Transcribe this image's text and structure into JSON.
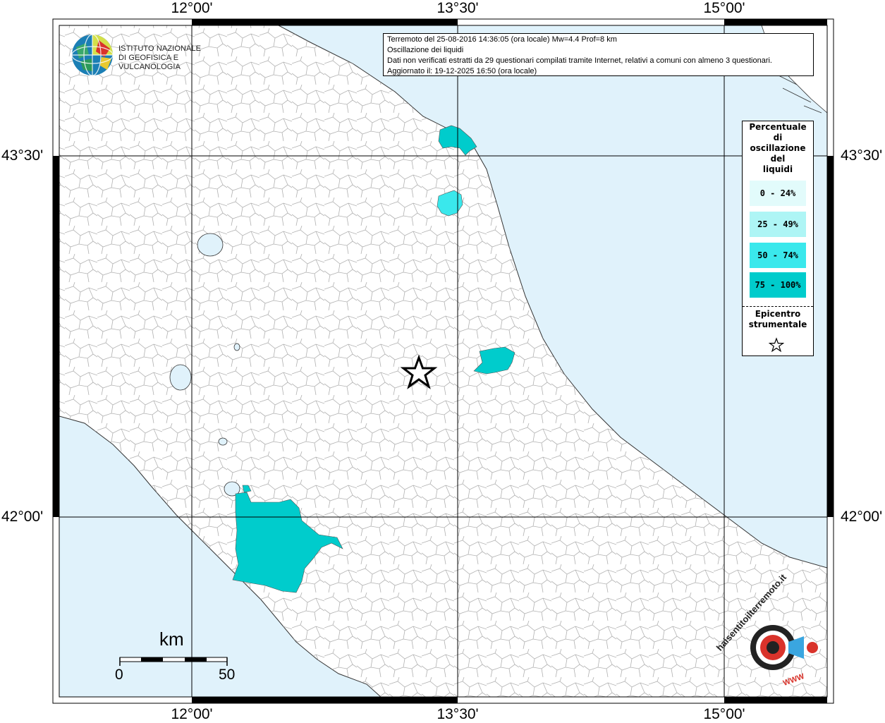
{
  "coordinates": {
    "top": [
      "12°00'",
      "13°30'",
      "15°00'"
    ],
    "bottom": [
      "12°00'",
      "13°30'",
      "15°00'"
    ],
    "left": [
      "43°30'",
      "42°00'"
    ],
    "right": [
      "43°30'",
      "42°00'"
    ]
  },
  "logo": {
    "line1": "ISTITUTO NAZIONALE",
    "line2": "DI GEOFISICA E VULCANOLOGIA"
  },
  "info": {
    "line1": "Terremoto del 25-08-2016 14:36:05 (ora locale) Mw=4.4 Prof=8 km",
    "line2": "Oscillazione dei liquidi",
    "line3": "Dati non verificati estratti da 29 questionari compilati tramite Internet, relativi a comuni con almeno 3 questionari.",
    "line4": "Aggiornato il: 19-12-2025 16:50 (ora locale)"
  },
  "legend": {
    "title_lines": [
      "Percentuale",
      "di",
      "oscillazione",
      "del",
      "liquidi"
    ],
    "items": [
      {
        "label": "0 - 24%",
        "color": "#e2fbfb"
      },
      {
        "label": "25 - 49%",
        "color": "#aef5f5"
      },
      {
        "label": "50 - 74%",
        "color": "#3ae8ec"
      },
      {
        "label": "75 - 100%",
        "color": "#00cccc"
      }
    ],
    "epicenter_lines": [
      "Epicentro",
      "strumentale"
    ]
  },
  "scale": {
    "unit": "km",
    "min_label": "0",
    "max_label": "50"
  },
  "colors": {
    "sea": "#e0f2fb",
    "land": "#ffffff",
    "lake": "#e0f2fb",
    "felt_high": "#00cccc",
    "felt_mid": "#3ae8ec",
    "felt_low": "#aef5f5",
    "grid": "#000000",
    "border_lines": "#999999"
  },
  "hsi_logo": {
    "text": "haisentitoilterremoto.it",
    "www": "WWW"
  }
}
